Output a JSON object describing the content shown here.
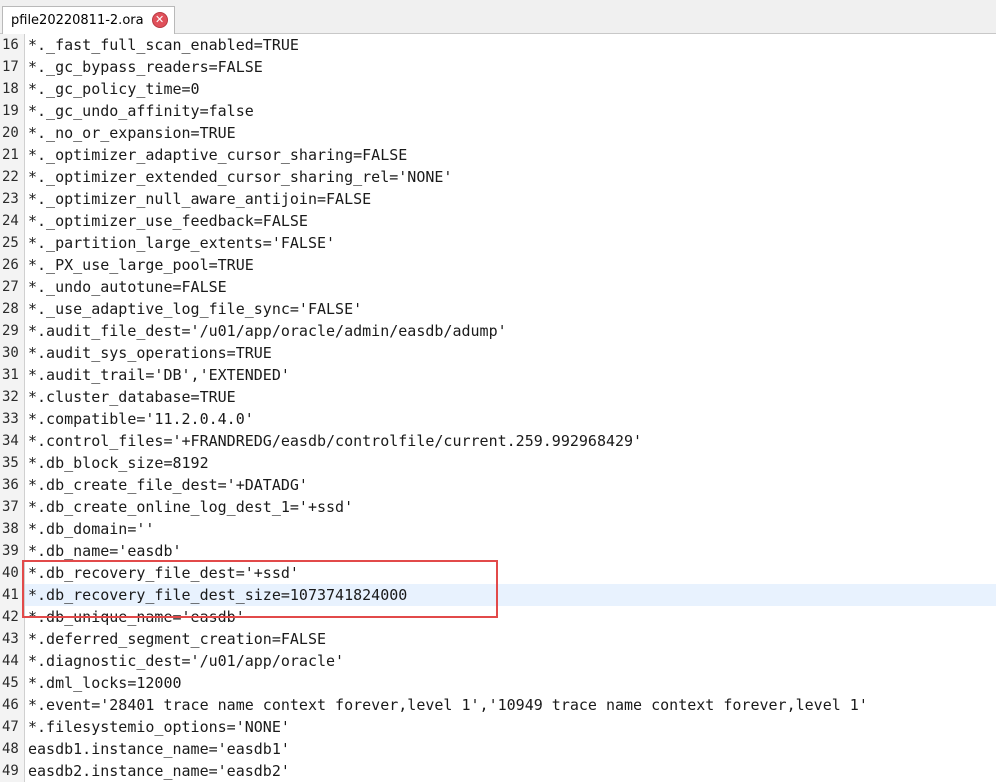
{
  "tabs": [
    {
      "label": "pfile20220811-2.ora",
      "close_icon": "close-icon",
      "close_symbol": "✕",
      "active": true
    }
  ],
  "editor": {
    "current_line": "41",
    "highlight_color": "#e24a4a",
    "lines": [
      {
        "num": "16",
        "text": "*._fast_full_scan_enabled=TRUE"
      },
      {
        "num": "17",
        "text": "*._gc_bypass_readers=FALSE"
      },
      {
        "num": "18",
        "text": "*._gc_policy_time=0"
      },
      {
        "num": "19",
        "text": "*._gc_undo_affinity=false"
      },
      {
        "num": "20",
        "text": "*._no_or_expansion=TRUE"
      },
      {
        "num": "21",
        "text": "*._optimizer_adaptive_cursor_sharing=FALSE"
      },
      {
        "num": "22",
        "text": "*._optimizer_extended_cursor_sharing_rel='NONE'"
      },
      {
        "num": "23",
        "text": "*._optimizer_null_aware_antijoin=FALSE"
      },
      {
        "num": "24",
        "text": "*._optimizer_use_feedback=FALSE"
      },
      {
        "num": "25",
        "text": "*._partition_large_extents='FALSE'"
      },
      {
        "num": "26",
        "text": "*._PX_use_large_pool=TRUE"
      },
      {
        "num": "27",
        "text": "*._undo_autotune=FALSE"
      },
      {
        "num": "28",
        "text": "*._use_adaptive_log_file_sync='FALSE'"
      },
      {
        "num": "29",
        "text": "*.audit_file_dest='/u01/app/oracle/admin/easdb/adump'"
      },
      {
        "num": "30",
        "text": "*.audit_sys_operations=TRUE"
      },
      {
        "num": "31",
        "text": "*.audit_trail='DB','EXTENDED'"
      },
      {
        "num": "32",
        "text": "*.cluster_database=TRUE"
      },
      {
        "num": "33",
        "text": "*.compatible='11.2.0.4.0'"
      },
      {
        "num": "34",
        "text": "*.control_files='+FRANDREDG/easdb/controlfile/current.259.992968429'"
      },
      {
        "num": "35",
        "text": "*.db_block_size=8192"
      },
      {
        "num": "36",
        "text": "*.db_create_file_dest='+DATADG'"
      },
      {
        "num": "37",
        "text": "*.db_create_online_log_dest_1='+ssd'"
      },
      {
        "num": "38",
        "text": "*.db_domain=''"
      },
      {
        "num": "39",
        "text": "*.db_name='easdb'"
      },
      {
        "num": "40",
        "text": "*.db_recovery_file_dest='+ssd'"
      },
      {
        "num": "41",
        "text": "*.db_recovery_file_dest_size=1073741824000"
      },
      {
        "num": "42",
        "text": "*.db_unique_name='easdb'"
      },
      {
        "num": "43",
        "text": "*.deferred_segment_creation=FALSE"
      },
      {
        "num": "44",
        "text": "*.diagnostic_dest='/u01/app/oracle'"
      },
      {
        "num": "45",
        "text": "*.dml_locks=12000"
      },
      {
        "num": "46",
        "text": "*.event='28401 trace name context forever,level 1','10949 trace name context forever,level 1'"
      },
      {
        "num": "47",
        "text": "*.filesystemio_options='NONE'"
      },
      {
        "num": "48",
        "text": "easdb1.instance_name='easdb1'"
      },
      {
        "num": "49",
        "text": "easdb2.instance_name='easdb2'"
      }
    ]
  }
}
